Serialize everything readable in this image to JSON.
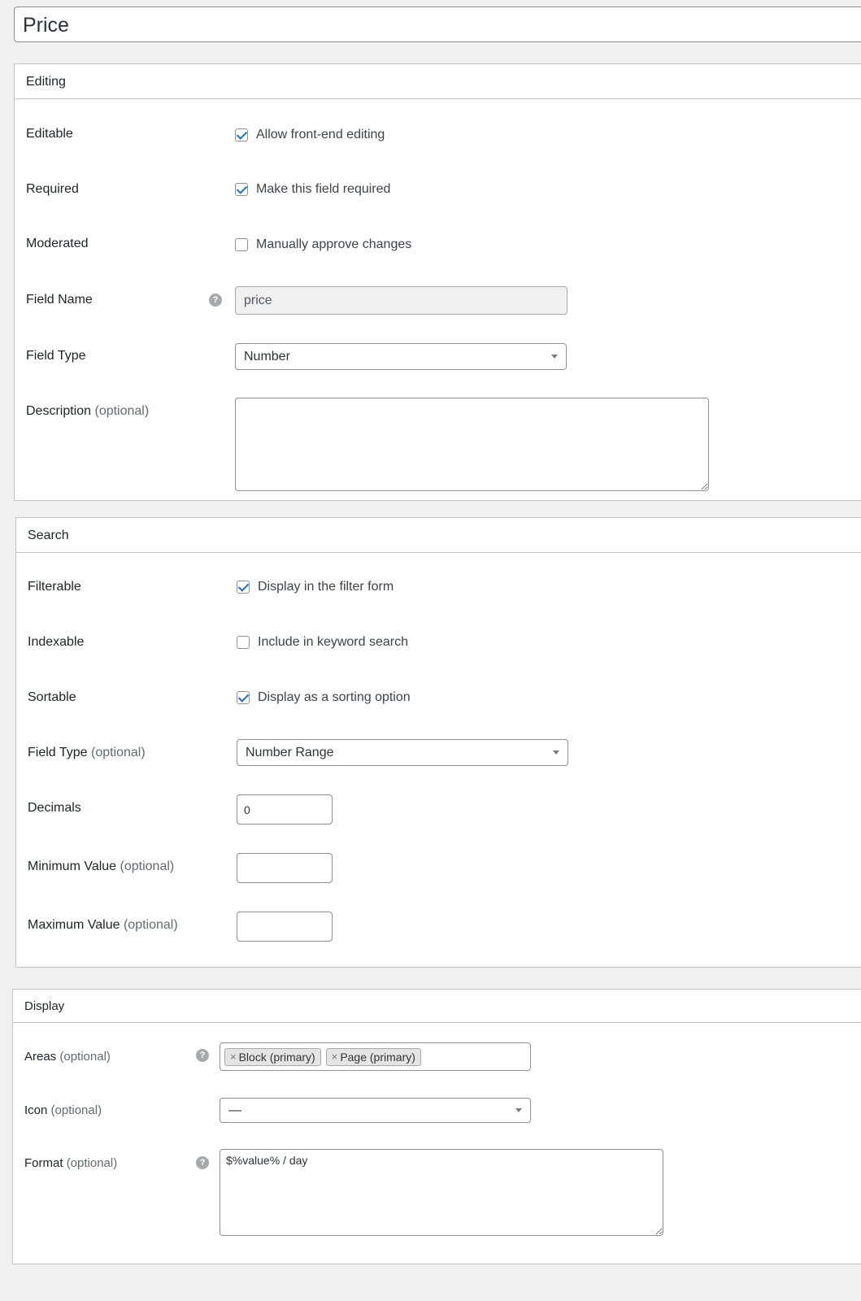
{
  "title": {
    "value": "Price"
  },
  "editing": {
    "heading": "Editing",
    "editable": {
      "label": "Editable",
      "check_label": "Allow front-end editing",
      "checked": true
    },
    "required": {
      "label": "Required",
      "check_label": "Make this field required",
      "checked": true
    },
    "moderated": {
      "label": "Moderated",
      "check_label": "Manually approve changes",
      "checked": false
    },
    "field_name": {
      "label": "Field Name",
      "value": "price"
    },
    "field_type": {
      "label": "Field Type",
      "value": "Number"
    },
    "description": {
      "label": "Description",
      "optional": "(optional)",
      "value": ""
    }
  },
  "search": {
    "heading": "Search",
    "filterable": {
      "label": "Filterable",
      "check_label": "Display in the filter form",
      "checked": true
    },
    "indexable": {
      "label": "Indexable",
      "check_label": "Include in keyword search",
      "checked": false
    },
    "sortable": {
      "label": "Sortable",
      "check_label": "Display as a sorting option",
      "checked": true
    },
    "field_type": {
      "label": "Field Type",
      "optional": "(optional)",
      "value": "Number Range"
    },
    "decimals": {
      "label": "Decimals",
      "value": "0"
    },
    "min_value": {
      "label": "Minimum Value",
      "optional": "(optional)",
      "value": ""
    },
    "max_value": {
      "label": "Maximum Value",
      "optional": "(optional)",
      "value": ""
    }
  },
  "display": {
    "heading": "Display",
    "areas": {
      "label": "Areas",
      "optional": "(optional)",
      "chips": [
        "Block (primary)",
        "Page (primary)"
      ]
    },
    "icon": {
      "label": "Icon",
      "optional": "(optional)",
      "value": "—"
    },
    "format": {
      "label": "Format",
      "optional": "(optional)",
      "value": "$%value% / day"
    }
  },
  "help_icon": "?",
  "remove_icon": "×",
  "colors": {
    "accent": "#2271b1",
    "panel_border": "#c3c4c7",
    "background": "#f0f0f1"
  }
}
